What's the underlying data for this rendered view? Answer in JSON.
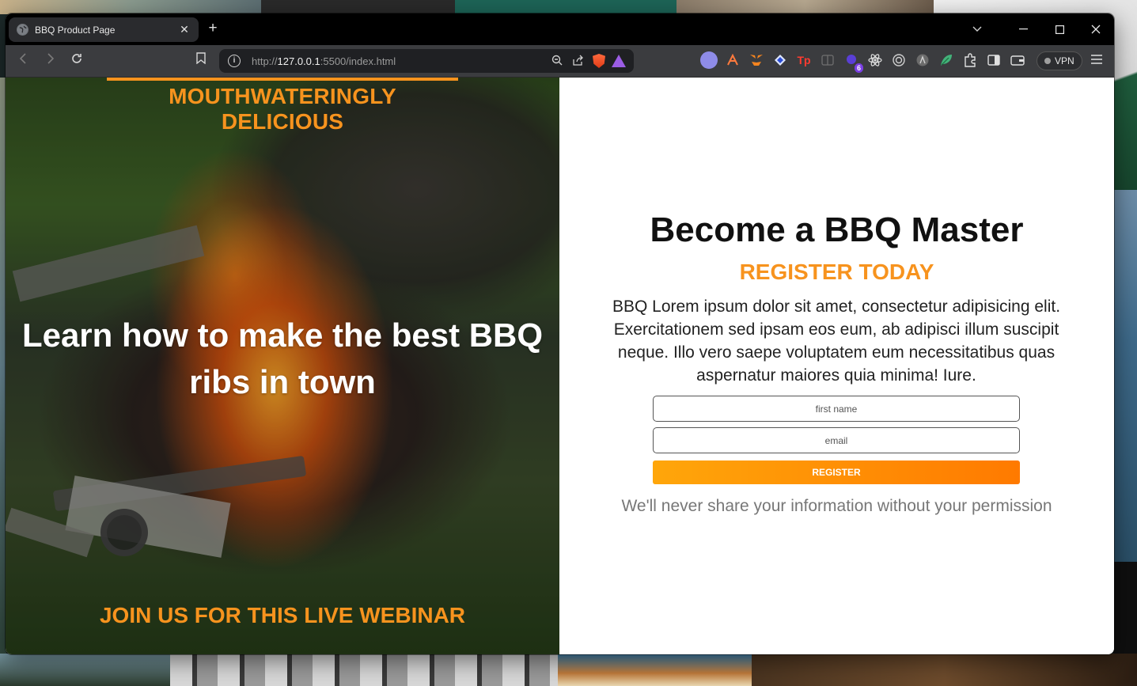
{
  "browser": {
    "tab_title": "BBQ Product Page",
    "url_scheme": "http://",
    "url_host": "127.0.0.1",
    "url_path": ":5500/index.html",
    "vpn_label": "VPN",
    "extension_badge": "6",
    "extension_tp_label": "Tp"
  },
  "hero": {
    "eyebrow": "MOUTHWATERINGLY DELICIOUS",
    "headline_start": "Learn how to make ",
    "headline_bold1": "the best BBQ",
    "headline_bold2": "ribs",
    "headline_end": " in town",
    "cta": "JOIN US FOR THIS LIVE WEBINAR"
  },
  "form": {
    "title": "Become a BBQ Master",
    "subtitle": "REGISTER TODAY",
    "body": "BBQ Lorem ipsum dolor sit amet, consectetur adipisicing elit. Exercitationem sed ipsam eos eum, ab adipisci illum suscipit neque. Illo vero saepe voluptatem eum necessitatibus quas aspernatur maiores quia minima! Iure.",
    "first_name_placeholder": "first name",
    "email_placeholder": "email",
    "register_label": "REGISTER",
    "privacy_note": "We'll never share your information without your permission"
  },
  "colors": {
    "accent": "#f7931e",
    "button_gradient_start": "#ffa60a",
    "button_gradient_end": "#ff7a00"
  }
}
